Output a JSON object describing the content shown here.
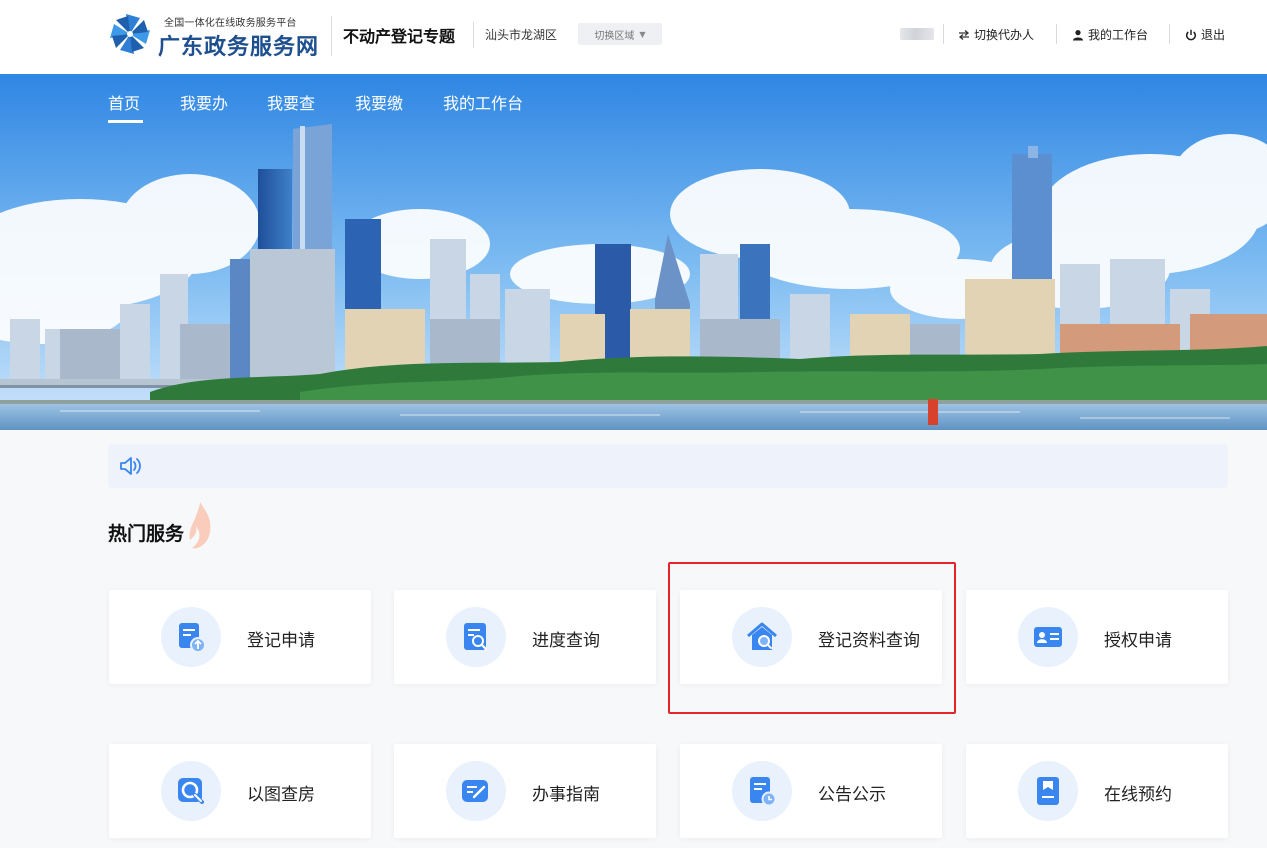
{
  "header": {
    "platform_tagline": "全国一体化在线政务服务平台",
    "site_name": "广东政务服务网",
    "topic": "不动产登记专题",
    "region": "汕头市龙湖区",
    "switch_region_label": "切换区域",
    "switch_agent_label": "切换代办人",
    "workbench_label": "我的工作台",
    "logout_label": "退出"
  },
  "nav": {
    "items": [
      {
        "label": "首页",
        "active": true
      },
      {
        "label": "我要办"
      },
      {
        "label": "我要查"
      },
      {
        "label": "我要缴"
      },
      {
        "label": "我的工作台"
      }
    ]
  },
  "section": {
    "title": "热门服务"
  },
  "services": [
    {
      "label": "登记申请",
      "icon": "document-upload-icon"
    },
    {
      "label": "进度查询",
      "icon": "document-search-icon"
    },
    {
      "label": "登记资料查询",
      "icon": "house-search-icon",
      "highlighted": true
    },
    {
      "label": "授权申请",
      "icon": "id-card-icon"
    },
    {
      "label": "以图查房",
      "icon": "map-search-icon"
    },
    {
      "label": "办事指南",
      "icon": "guide-edit-icon"
    },
    {
      "label": "公告公示",
      "icon": "notice-clock-icon"
    },
    {
      "label": "在线预约",
      "icon": "bookmark-icon"
    }
  ],
  "colors": {
    "brand_blue": "#1e4f8f",
    "icon_blue": "#3a86f0",
    "icon_circle_bg": "#e9f1fd",
    "highlight_red": "#e5252a",
    "notice_bg": "#eef2fb"
  }
}
